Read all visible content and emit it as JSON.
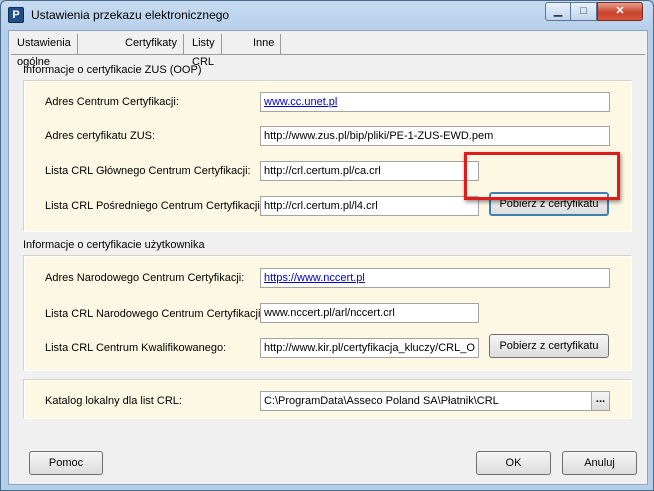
{
  "window": {
    "title": "Ustawienia przekazu elektronicznego",
    "icon": "P",
    "controls": {
      "minimize": "▁",
      "maximize": "□",
      "close": "✕"
    }
  },
  "tabs": [
    {
      "label": "Ustawienia ogólne",
      "active": false
    },
    {
      "label": "Certyfikaty",
      "active": false
    },
    {
      "label": "Listy CRL",
      "active": true
    },
    {
      "label": "Inne",
      "active": false
    }
  ],
  "zus_group": {
    "title": "Informacje o certyfikacie ZUS (OOP)",
    "rows": [
      {
        "label": "Adres Centrum Certyfikacji:",
        "value": "www.cc.unet.pl"
      },
      {
        "label": "Adres certyfikatu ZUS:",
        "value": "http://www.zus.pl/bip/pliki/PE-1-ZUS-EWD.pem"
      },
      {
        "label": "Lista CRL Głównego Centrum Certyfikacji:",
        "value": "http://crl.certum.pl/ca.crl"
      },
      {
        "label": "Lista CRL Pośredniego Centrum Certyfikacji:",
        "value": "http://crl.certum.pl/l4.crl"
      }
    ],
    "fetch_button": "Pobierz z certyfikatu"
  },
  "user_group": {
    "title": "Informacje o certyfikacie użytkownika",
    "rows": [
      {
        "label": "Adres Narodowego Centrum Certyfikacji:",
        "value": "https://www.nccert.pl"
      },
      {
        "label": "Lista CRL Narodowego Centrum Certyfikacji:",
        "value": "www.nccert.pl/arl/nccert.crl"
      },
      {
        "label": "Lista CRL Centrum Kwalifikowanego:",
        "value": "http://www.kir.pl/certyfikacja_kluczy/CRL_O"
      }
    ],
    "fetch_button": "Pobierz z certyfikatu"
  },
  "local_catalog": {
    "label": "Katalog lokalny dla list CRL:",
    "value": "C:\\ProgramData\\Asseco Poland SA\\Płatnik\\CRL",
    "browse": "..."
  },
  "footer": {
    "help": "Pomoc",
    "ok": "OK",
    "cancel": "Anuluj"
  }
}
